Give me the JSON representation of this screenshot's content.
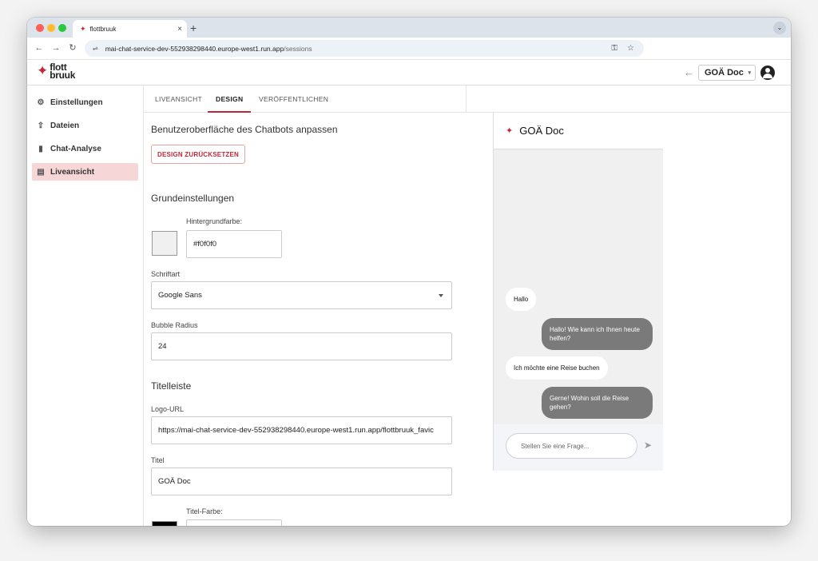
{
  "browser": {
    "tab_title": "flottbruuk",
    "tab_close": "×",
    "new_tab": "+",
    "tab_menu": "⌄",
    "url_host": "mai-chat-service-dev-552938298440.europe-west1.run.app",
    "url_path": "/sessions",
    "nav_back": "←",
    "nav_forward": "→",
    "nav_reload": "↻",
    "site_info_icon": "⇌",
    "password_icon": "⚿",
    "bookmark_icon": "☆"
  },
  "header": {
    "logo_line1": "flott",
    "logo_line2": "bruuk",
    "back_arrow": "←",
    "doc_select": "GOÄ Doc"
  },
  "sidebar": {
    "items": [
      {
        "label": "Einstellungen",
        "icon": "⚙"
      },
      {
        "label": "Dateien",
        "icon": "⇪"
      },
      {
        "label": "Chat-Analyse",
        "icon": "▮"
      },
      {
        "label": "Liveansicht",
        "icon": "▤"
      }
    ],
    "active_index": 3
  },
  "tabs": [
    {
      "label": "LIVEANSICHT"
    },
    {
      "label": "DESIGN"
    },
    {
      "label": "VERÖFFENTLICHEN"
    }
  ],
  "form": {
    "page_title": "Benutzeroberfläche des Chatbots anpassen",
    "reset_label": "DESIGN ZURÜCKSETZEN",
    "section_basic": "Grundeinstellungen",
    "bg_color_label": "Hintergrundfarbe:",
    "bg_color_value": "#f0f0f0",
    "font_label": "Schriftart",
    "font_value": "Google Sans",
    "radius_label": "Bubble Radius",
    "radius_value": "24",
    "section_titlebar": "Titelleiste",
    "logo_url_label": "Logo-URL",
    "logo_url_value": "https://mai-chat-service-dev-552938298440.europe-west1.run.app/flottbruuk_favic",
    "title_label": "Titel",
    "title_value": "GOÄ Doc",
    "title_color_label": "Titel-Farbe:",
    "title_color_value": "#000000"
  },
  "preview": {
    "title": "GOÄ Doc",
    "messages": [
      {
        "role": "user",
        "text": "Hallo"
      },
      {
        "role": "bot",
        "text": "Hallo! Wie kann ich Ihnen heute helfen?"
      },
      {
        "role": "user",
        "text": "Ich möchte eine Reise buchen"
      },
      {
        "role": "bot",
        "text": "Gerne! Wohin soll die Reise gehen?"
      }
    ],
    "input_placeholder": "Stellen Sie eine Frage...",
    "send_icon": "➤"
  },
  "colors": {
    "brand": "#c0283a",
    "active_nav": "#f6d6d6",
    "bot_bubble": "#7a7a7a"
  }
}
